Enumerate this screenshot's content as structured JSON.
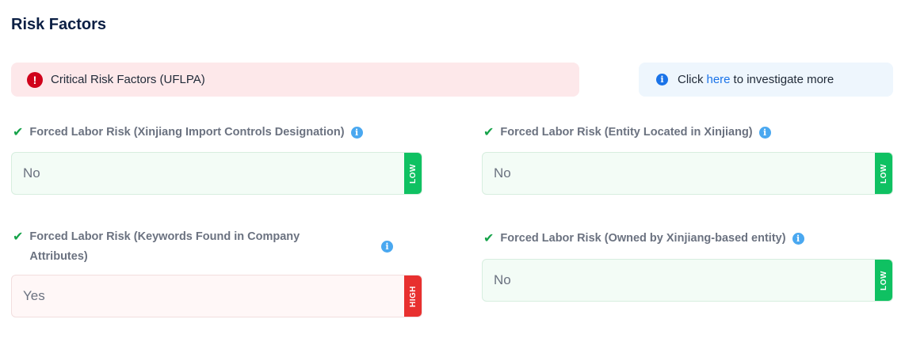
{
  "page": {
    "title": "Risk Factors"
  },
  "alert": {
    "icon": "!",
    "text": "Critical Risk Factors (UFLPA)"
  },
  "info_banner": {
    "icon": "i",
    "prefix": "Click",
    "link_text": "here",
    "suffix": "to investigate more"
  },
  "fields": [
    {
      "label": "Forced Labor Risk (Xinjiang Import Controls Designation)",
      "value": "No",
      "level": "LOW"
    },
    {
      "label": "Forced Labor Risk (Entity Located in Xinjiang)",
      "value": "No",
      "level": "LOW"
    },
    {
      "label_line1": "Forced Labor Risk (Keywords Found in Company",
      "label_line2": "Attributes)",
      "value": "Yes",
      "level": "HIGH"
    },
    {
      "label": "Forced Labor Risk (Owned by Xinjiang-based entity)",
      "value": "No",
      "level": "LOW"
    }
  ],
  "icons": {
    "check": "✔",
    "info": "i"
  },
  "colors": {
    "low": "#0fc162",
    "high": "#e8302f",
    "alert_bg": "#fde8ea",
    "link": "#1a73e8"
  }
}
